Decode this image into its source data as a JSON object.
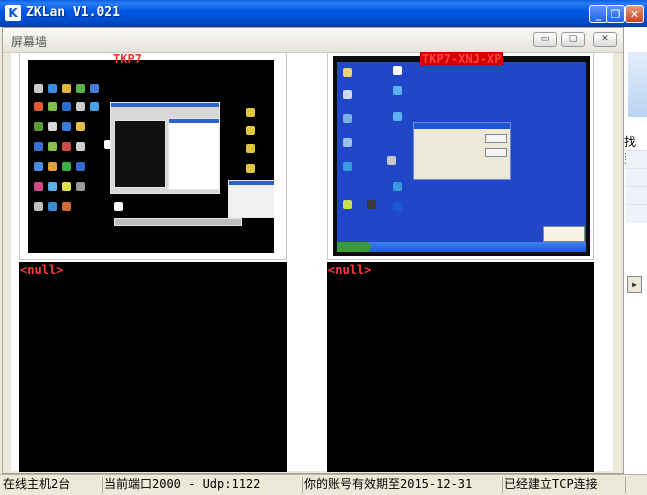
{
  "window": {
    "title": "ZKLan V1.021",
    "icon_letter": "K",
    "min_glyph": "_",
    "max_glyph": "❐",
    "close_glyph": "✕"
  },
  "child_window": {
    "title": "屏幕墙",
    "min_glyph": "▭",
    "max_glyph": "▢",
    "close_glyph": "✕"
  },
  "behind": {
    "visible_label": "找到"
  },
  "screens": [
    {
      "label": "TKP7",
      "has_image": true
    },
    {
      "label": "TKP7-XNJ-XP",
      "has_image": true
    },
    {
      "label": "<null>",
      "has_image": false
    },
    {
      "label": "<null>",
      "has_image": false
    }
  ],
  "status": {
    "online": "在线主机2台",
    "port": "当前端口2000 - Udp:1122",
    "expiry": "你的账号有效期至2015-12-31",
    "connection": "已经建立TCP连接"
  },
  "colors": {
    "title_blue": "#0058e6",
    "label_red": "#ff3232",
    "xp_desktop_blue": "#1f47c8"
  }
}
